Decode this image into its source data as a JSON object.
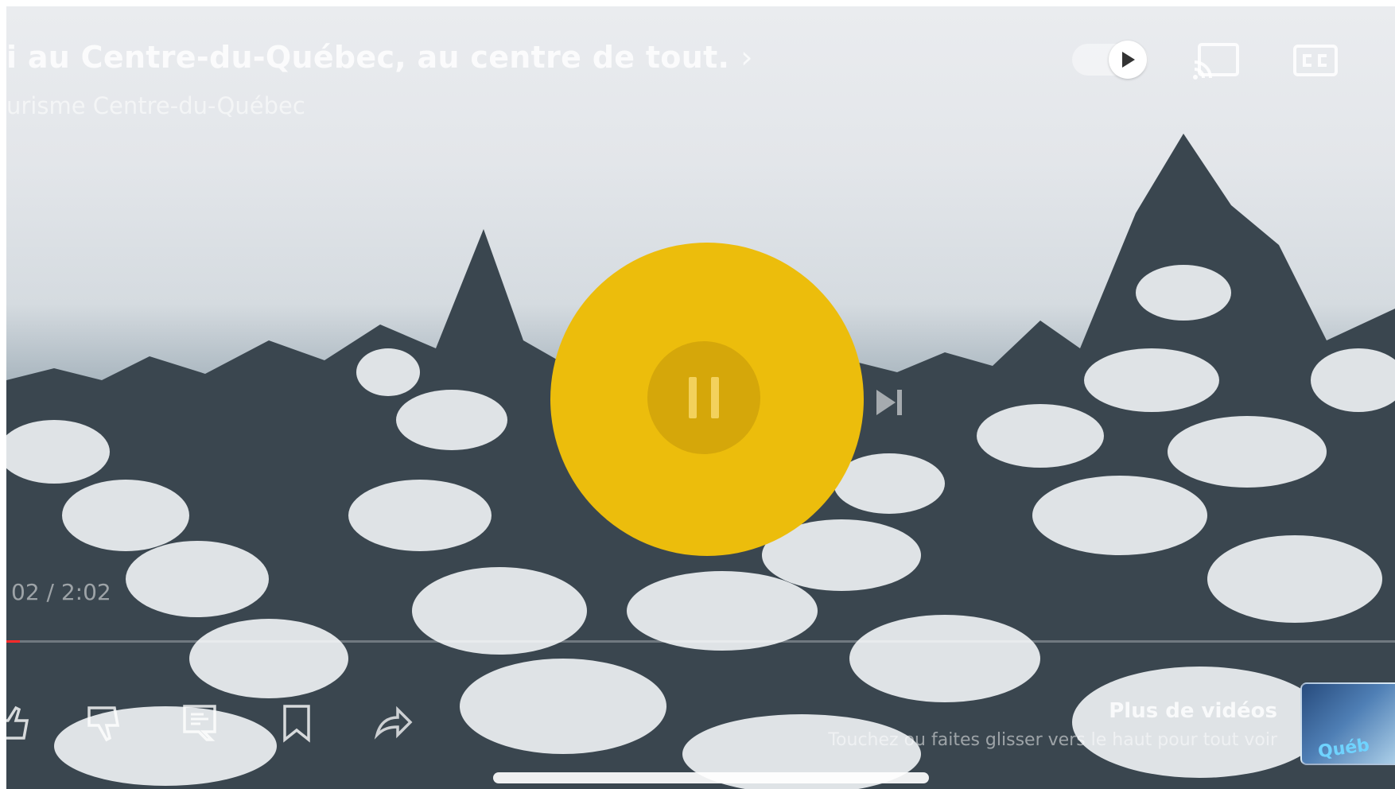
{
  "video": {
    "title": "i au Centre-du-Québec, au centre de tout.",
    "title_chevron": "›",
    "channel": "urisme Centre-du-Québec"
  },
  "player": {
    "time": "02 / 2:02",
    "progress_fraction": 0.01,
    "progress_color": "#ff2a2a",
    "overlay_color": "#ecbd0c",
    "autoplay": "on"
  },
  "icons": {
    "autoplay": "play-icon",
    "cast": "cast-icon",
    "captions": "cc-icon",
    "pause": "pause-icon",
    "next": "next-icon",
    "like": "thumbs-up-icon",
    "dislike": "thumbs-down-icon",
    "comments": "comments-icon",
    "save": "bookmark-icon",
    "share": "share-icon"
  },
  "more_videos": {
    "title": "Plus de vidéos",
    "hint": "Touchez ou faites glisser vers le haut pour tout voir",
    "thumbnail_text": "Québ"
  }
}
